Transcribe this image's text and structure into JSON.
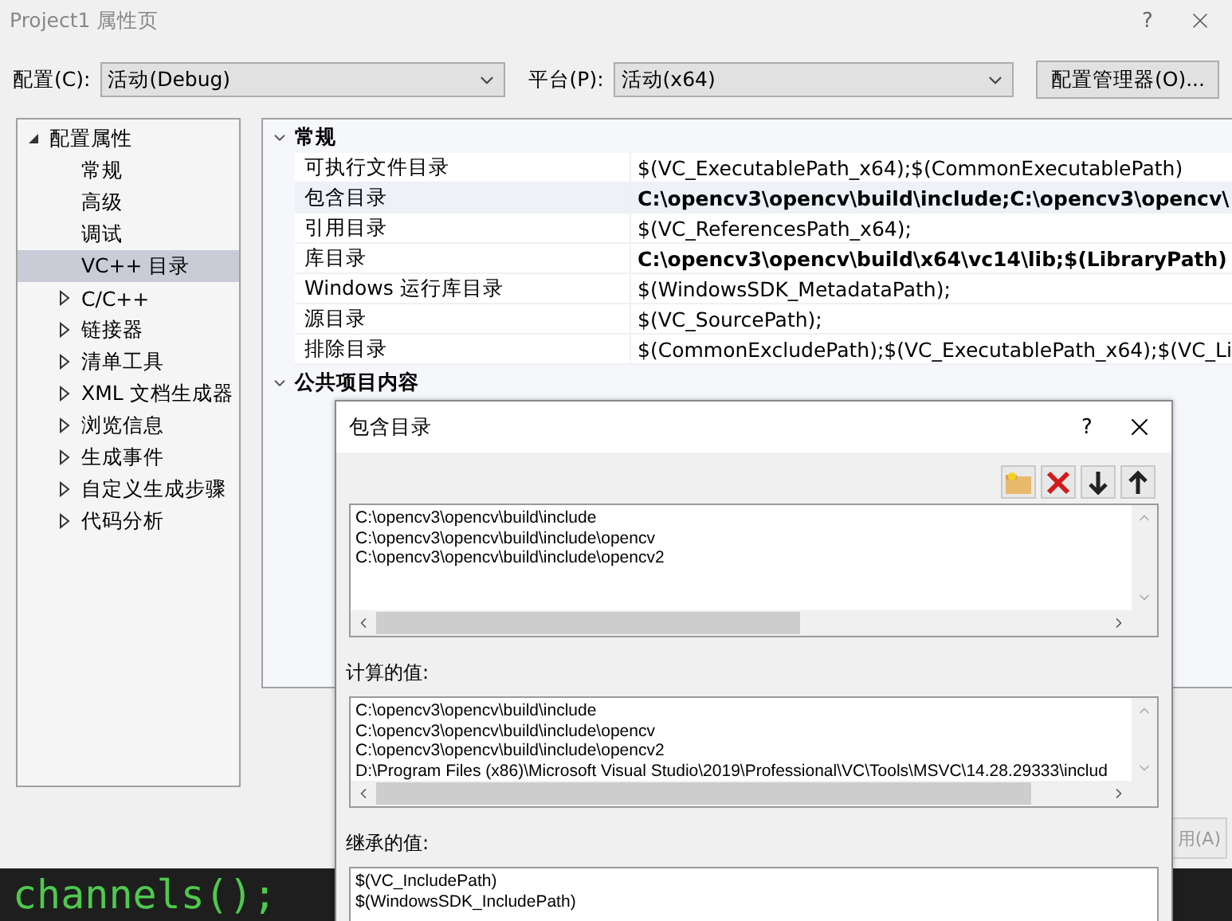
{
  "window": {
    "title": "Project1 属性页",
    "help": "?"
  },
  "config": {
    "label": "配置(C):",
    "value": "活动(Debug)"
  },
  "platform": {
    "label": "平台(P):",
    "value": "活动(x64)"
  },
  "manager_button": "配置管理器(O)...",
  "tree": [
    {
      "label": "配置属性",
      "selected": false,
      "expanded": true,
      "children": [
        {
          "label": "常规",
          "selected": false
        },
        {
          "label": "高级",
          "selected": false
        },
        {
          "label": "调试",
          "selected": false
        },
        {
          "label": "VC++ 目录",
          "selected": true
        },
        {
          "label": "C/C++",
          "selected": false,
          "expanded": false
        },
        {
          "label": "链接器",
          "selected": false,
          "expanded": false
        },
        {
          "label": "清单工具",
          "selected": false,
          "expanded": false
        },
        {
          "label": "XML 文档生成器",
          "selected": false,
          "expanded": false
        },
        {
          "label": "浏览信息",
          "selected": false,
          "expanded": false
        },
        {
          "label": "生成事件",
          "selected": false,
          "expanded": false
        },
        {
          "label": "自定义生成步骤",
          "selected": false,
          "expanded": false
        },
        {
          "label": "代码分析",
          "selected": false,
          "expanded": false
        }
      ]
    }
  ],
  "grid": [
    {
      "title": "常规",
      "expanded": true,
      "rows": [
        {
          "name": "可执行文件目录",
          "value": "$(VC_ExecutablePath_x64);$(CommonExecutablePath)",
          "bold": false,
          "selected": false
        },
        {
          "name": "包含目录",
          "value": "C:\\opencv3\\opencv\\build\\include;C:\\opencv3\\opencv\\",
          "bold": true,
          "selected": true
        },
        {
          "name": "引用目录",
          "value": "$(VC_ReferencesPath_x64);",
          "bold": false,
          "selected": false
        },
        {
          "name": "库目录",
          "value": "C:\\opencv3\\opencv\\build\\x64\\vc14\\lib;$(LibraryPath)",
          "bold": true,
          "selected": false
        },
        {
          "name": "Windows 运行库目录",
          "value": "$(WindowsSDK_MetadataPath);",
          "bold": false,
          "selected": false
        },
        {
          "name": "源目录",
          "value": "$(VC_SourcePath);",
          "bold": false,
          "selected": false
        },
        {
          "name": "排除目录",
          "value": "$(CommonExcludePath);$(VC_ExecutablePath_x64);$(VC_Li",
          "bold": false,
          "selected": false
        }
      ]
    },
    {
      "title": "公共项目内容",
      "expanded": true
    }
  ],
  "apply_button": "用(A)",
  "code_text": "channels();",
  "dialog": {
    "title": "包含目录",
    "help": "?",
    "entries": [
      "C:\\opencv3\\opencv\\build\\include",
      "C:\\opencv3\\opencv\\build\\include\\opencv",
      "C:\\opencv3\\opencv\\build\\include\\opencv2"
    ],
    "computed_label": "计算的值:",
    "computed": [
      "C:\\opencv3\\opencv\\build\\include",
      "C:\\opencv3\\opencv\\build\\include\\opencv",
      "C:\\opencv3\\opencv\\build\\include\\opencv2",
      "D:\\Program Files (x86)\\Microsoft Visual Studio\\2019\\Professional\\VC\\Tools\\MSVC\\14.28.29333\\includ"
    ],
    "inherited_label": "继承的值:",
    "inherited": [
      "$(VC_IncludePath)",
      "$(WindowsSDK_IncludePath)"
    ]
  }
}
